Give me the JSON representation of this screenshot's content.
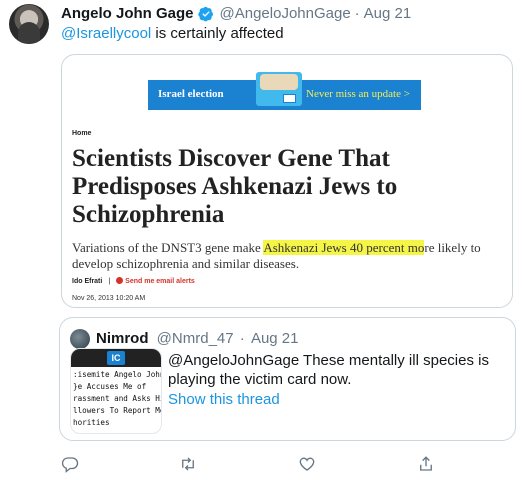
{
  "tweet": {
    "display_name": "Angelo John Gage",
    "handle": "@AngeloJohnGage",
    "date": "Aug 21",
    "text_mention": "@Israellycool",
    "text_rest": " is certainly affected"
  },
  "image_card": {
    "banner_logo": "Israel election",
    "banner_cta": "Never miss an update >",
    "breadcrumb": "Home",
    "headline": "Scientists Discover Gene That Predisposes Ashkenazi Jews to Schizophrenia",
    "dek_before": "Variations of the DNST3 gene make ",
    "dek_highlight": "Ashkenazi Jews 40 percent mo",
    "dek_after": "re likely to develop schizophrenia and similar diseases.",
    "author": "Ido Efrati",
    "separator": "|",
    "alert_link": "Send me email alerts",
    "timestamp": "Nov 26, 2013 10:20 AM"
  },
  "quote": {
    "display_name": "Nimrod",
    "handle": "@Nmrd_47",
    "date": "Aug 21",
    "thumb_logo": "IC",
    "thumb_text": ":isemite Angelo John\n}e Accuses Me of\nrassment and Asks Hi\nllowers To Report Me\nhorities",
    "body": "@AngeloJohnGage These mentally ill species is playing the victim card now.",
    "show_thread": "Show this thread"
  },
  "actions": [
    "reply-icon",
    "retweet-icon",
    "like-icon",
    "share-icon"
  ],
  "colors": {
    "link": "#1b95e0",
    "secondary": "#657786",
    "highlight": "#f5f547",
    "banner": "#1b82d2"
  }
}
